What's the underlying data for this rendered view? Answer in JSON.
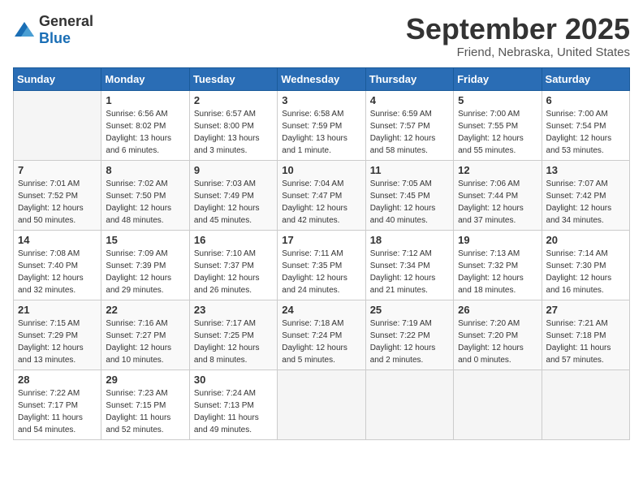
{
  "logo": {
    "general": "General",
    "blue": "Blue"
  },
  "header": {
    "title": "September 2025",
    "subtitle": "Friend, Nebraska, United States"
  },
  "weekdays": [
    "Sunday",
    "Monday",
    "Tuesday",
    "Wednesday",
    "Thursday",
    "Friday",
    "Saturday"
  ],
  "weeks": [
    [
      {
        "day": "",
        "sunrise": "",
        "sunset": "",
        "daylight": ""
      },
      {
        "day": "1",
        "sunrise": "Sunrise: 6:56 AM",
        "sunset": "Sunset: 8:02 PM",
        "daylight": "Daylight: 13 hours and 6 minutes."
      },
      {
        "day": "2",
        "sunrise": "Sunrise: 6:57 AM",
        "sunset": "Sunset: 8:00 PM",
        "daylight": "Daylight: 13 hours and 3 minutes."
      },
      {
        "day": "3",
        "sunrise": "Sunrise: 6:58 AM",
        "sunset": "Sunset: 7:59 PM",
        "daylight": "Daylight: 13 hours and 1 minute."
      },
      {
        "day": "4",
        "sunrise": "Sunrise: 6:59 AM",
        "sunset": "Sunset: 7:57 PM",
        "daylight": "Daylight: 12 hours and 58 minutes."
      },
      {
        "day": "5",
        "sunrise": "Sunrise: 7:00 AM",
        "sunset": "Sunset: 7:55 PM",
        "daylight": "Daylight: 12 hours and 55 minutes."
      },
      {
        "day": "6",
        "sunrise": "Sunrise: 7:00 AM",
        "sunset": "Sunset: 7:54 PM",
        "daylight": "Daylight: 12 hours and 53 minutes."
      }
    ],
    [
      {
        "day": "7",
        "sunrise": "Sunrise: 7:01 AM",
        "sunset": "Sunset: 7:52 PM",
        "daylight": "Daylight: 12 hours and 50 minutes."
      },
      {
        "day": "8",
        "sunrise": "Sunrise: 7:02 AM",
        "sunset": "Sunset: 7:50 PM",
        "daylight": "Daylight: 12 hours and 48 minutes."
      },
      {
        "day": "9",
        "sunrise": "Sunrise: 7:03 AM",
        "sunset": "Sunset: 7:49 PM",
        "daylight": "Daylight: 12 hours and 45 minutes."
      },
      {
        "day": "10",
        "sunrise": "Sunrise: 7:04 AM",
        "sunset": "Sunset: 7:47 PM",
        "daylight": "Daylight: 12 hours and 42 minutes."
      },
      {
        "day": "11",
        "sunrise": "Sunrise: 7:05 AM",
        "sunset": "Sunset: 7:45 PM",
        "daylight": "Daylight: 12 hours and 40 minutes."
      },
      {
        "day": "12",
        "sunrise": "Sunrise: 7:06 AM",
        "sunset": "Sunset: 7:44 PM",
        "daylight": "Daylight: 12 hours and 37 minutes."
      },
      {
        "day": "13",
        "sunrise": "Sunrise: 7:07 AM",
        "sunset": "Sunset: 7:42 PM",
        "daylight": "Daylight: 12 hours and 34 minutes."
      }
    ],
    [
      {
        "day": "14",
        "sunrise": "Sunrise: 7:08 AM",
        "sunset": "Sunset: 7:40 PM",
        "daylight": "Daylight: 12 hours and 32 minutes."
      },
      {
        "day": "15",
        "sunrise": "Sunrise: 7:09 AM",
        "sunset": "Sunset: 7:39 PM",
        "daylight": "Daylight: 12 hours and 29 minutes."
      },
      {
        "day": "16",
        "sunrise": "Sunrise: 7:10 AM",
        "sunset": "Sunset: 7:37 PM",
        "daylight": "Daylight: 12 hours and 26 minutes."
      },
      {
        "day": "17",
        "sunrise": "Sunrise: 7:11 AM",
        "sunset": "Sunset: 7:35 PM",
        "daylight": "Daylight: 12 hours and 24 minutes."
      },
      {
        "day": "18",
        "sunrise": "Sunrise: 7:12 AM",
        "sunset": "Sunset: 7:34 PM",
        "daylight": "Daylight: 12 hours and 21 minutes."
      },
      {
        "day": "19",
        "sunrise": "Sunrise: 7:13 AM",
        "sunset": "Sunset: 7:32 PM",
        "daylight": "Daylight: 12 hours and 18 minutes."
      },
      {
        "day": "20",
        "sunrise": "Sunrise: 7:14 AM",
        "sunset": "Sunset: 7:30 PM",
        "daylight": "Daylight: 12 hours and 16 minutes."
      }
    ],
    [
      {
        "day": "21",
        "sunrise": "Sunrise: 7:15 AM",
        "sunset": "Sunset: 7:29 PM",
        "daylight": "Daylight: 12 hours and 13 minutes."
      },
      {
        "day": "22",
        "sunrise": "Sunrise: 7:16 AM",
        "sunset": "Sunset: 7:27 PM",
        "daylight": "Daylight: 12 hours and 10 minutes."
      },
      {
        "day": "23",
        "sunrise": "Sunrise: 7:17 AM",
        "sunset": "Sunset: 7:25 PM",
        "daylight": "Daylight: 12 hours and 8 minutes."
      },
      {
        "day": "24",
        "sunrise": "Sunrise: 7:18 AM",
        "sunset": "Sunset: 7:24 PM",
        "daylight": "Daylight: 12 hours and 5 minutes."
      },
      {
        "day": "25",
        "sunrise": "Sunrise: 7:19 AM",
        "sunset": "Sunset: 7:22 PM",
        "daylight": "Daylight: 12 hours and 2 minutes."
      },
      {
        "day": "26",
        "sunrise": "Sunrise: 7:20 AM",
        "sunset": "Sunset: 7:20 PM",
        "daylight": "Daylight: 12 hours and 0 minutes."
      },
      {
        "day": "27",
        "sunrise": "Sunrise: 7:21 AM",
        "sunset": "Sunset: 7:18 PM",
        "daylight": "Daylight: 11 hours and 57 minutes."
      }
    ],
    [
      {
        "day": "28",
        "sunrise": "Sunrise: 7:22 AM",
        "sunset": "Sunset: 7:17 PM",
        "daylight": "Daylight: 11 hours and 54 minutes."
      },
      {
        "day": "29",
        "sunrise": "Sunrise: 7:23 AM",
        "sunset": "Sunset: 7:15 PM",
        "daylight": "Daylight: 11 hours and 52 minutes."
      },
      {
        "day": "30",
        "sunrise": "Sunrise: 7:24 AM",
        "sunset": "Sunset: 7:13 PM",
        "daylight": "Daylight: 11 hours and 49 minutes."
      },
      {
        "day": "",
        "sunrise": "",
        "sunset": "",
        "daylight": ""
      },
      {
        "day": "",
        "sunrise": "",
        "sunset": "",
        "daylight": ""
      },
      {
        "day": "",
        "sunrise": "",
        "sunset": "",
        "daylight": ""
      },
      {
        "day": "",
        "sunrise": "",
        "sunset": "",
        "daylight": ""
      }
    ]
  ]
}
